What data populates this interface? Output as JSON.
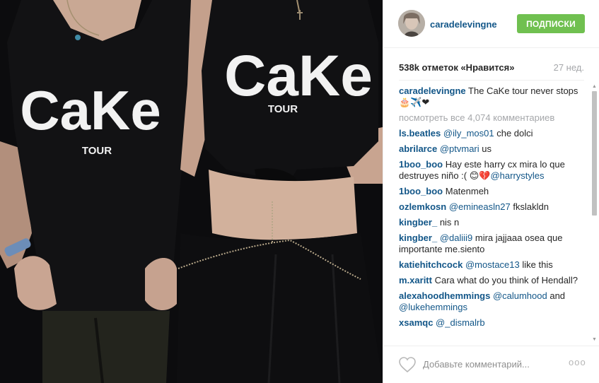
{
  "post": {
    "username": "caradelevingne",
    "follow_label": "ПОДПИСКИ",
    "likes": "538k отметок «Нравится»",
    "time_ago": "27 нед.",
    "view_all": "посмотреть все 4,074 комментариев",
    "add_comment_placeholder": "Добавьте комментарий...",
    "more": "ooo",
    "colors": {
      "username": "#125688",
      "follow_button": "#70c050",
      "muted": "#a5a7aa"
    }
  },
  "photo": {
    "shirt_brand": "CaKe",
    "shirt_sub": "TOUR"
  },
  "caption": {
    "user": "caradelevingne",
    "text": "The CaKe tour never stops 🎂✈️❤"
  },
  "comments": [
    {
      "user": "ls.beatles",
      "mention": "@ily_mos01",
      "text": " che dolci"
    },
    {
      "user": "abrilarce",
      "mention": "@ptvmari",
      "text": " us"
    },
    {
      "user": "1boo_boo",
      "mention": "",
      "text": "Hay este harry cx mira lo que destruyes niño :( 😊💔",
      "mention2": "@harrystyles"
    },
    {
      "user": "1boo_boo",
      "mention": "",
      "text": "Matenmeh"
    },
    {
      "user": "ozlemkosn",
      "mention": "@emineasln27",
      "text": " fkslakldn"
    },
    {
      "user": "kingber_",
      "mention": "",
      "text": "nis n"
    },
    {
      "user": "kingber_",
      "mention": "@daliii9",
      "text": " mira jajjaaa osea que importante me.siento"
    },
    {
      "user": "katiehitchcock",
      "mention": "@mostace13",
      "text": " like this"
    },
    {
      "user": "m.xaritt",
      "mention": "",
      "text": "Cara what do you think of Hendall?"
    },
    {
      "user": "alexahoodhemmings",
      "mention": "@calumhood",
      "text": " and ",
      "mention2": "@lukehemmings"
    },
    {
      "user": "xsamqc",
      "mention": "@_dismalrb",
      "text": ""
    }
  ]
}
